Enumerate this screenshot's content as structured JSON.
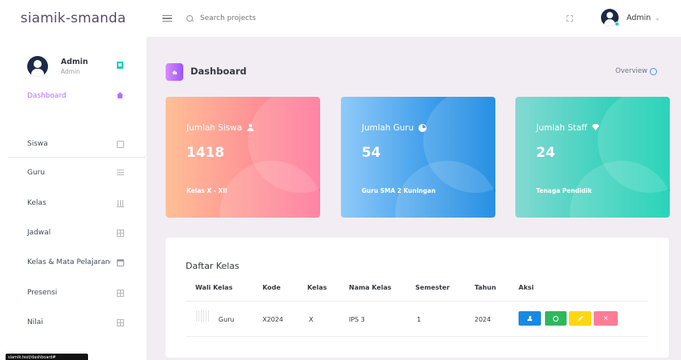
{
  "app": {
    "brand": "siamik-smanda"
  },
  "topbar": {
    "search_placeholder": "Search projects",
    "user_name": "Admin"
  },
  "sidebar": {
    "profile": {
      "name": "Admin",
      "role": "Admin"
    },
    "items": [
      {
        "label": "Dashboard",
        "icon": "home-icon",
        "active": true
      },
      {
        "label": "Siswa",
        "icon": "id-card-icon"
      },
      {
        "label": "Guru",
        "icon": "list-icon"
      },
      {
        "label": "Kelas",
        "icon": "chart-icon"
      },
      {
        "label": "Jadwal",
        "icon": "table-icon"
      },
      {
        "label": "Kelas & Mata Pelajaran",
        "icon": "briefcase-icon"
      },
      {
        "label": "Presensi",
        "icon": "table-icon"
      },
      {
        "label": "Nilai",
        "icon": "table-icon"
      }
    ],
    "status_tooltip": "siamik.test/dashboard#"
  },
  "header": {
    "title": "Dashboard",
    "overview_label": "Overview"
  },
  "cards": [
    {
      "label": "Jumlah Siswa",
      "value": "1418",
      "sub": "Kelas X - XII",
      "icon": "user-icon",
      "color": "#fe7096"
    },
    {
      "label": "Jumlah Guru",
      "value": "54",
      "sub": "Guru SMA 2 Kuningan",
      "icon": "pie-chart-icon",
      "color": "#047edf"
    },
    {
      "label": "Jumlah Staff",
      "value": "24",
      "sub": "Tenaga Pendidik",
      "icon": "diamond-icon",
      "color": "#07cdae"
    }
  ],
  "table": {
    "title": "Daftar Kelas",
    "columns": [
      "Wali Kelas",
      "Kode",
      "Kelas",
      "Nama Kelas",
      "Semester",
      "Tahun",
      "Aksi"
    ],
    "rows": [
      {
        "wali": "Guru",
        "kode": "X2024",
        "kelas": "X",
        "nama_kelas": "IPS 3",
        "semester": "1",
        "tahun": "2024"
      }
    ],
    "actions": [
      "user-icon",
      "clock-icon",
      "pencil-icon",
      "close-icon"
    ]
  }
}
